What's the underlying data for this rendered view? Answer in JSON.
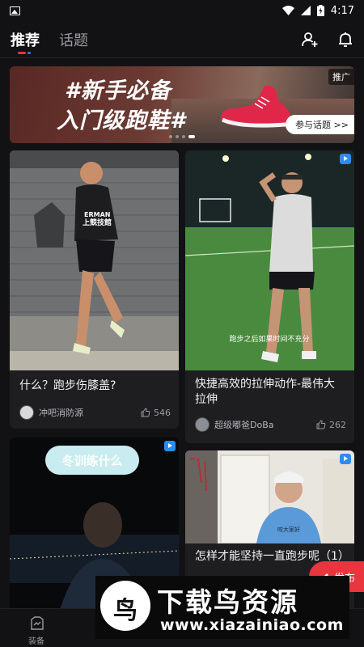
{
  "status_bar": {
    "time": "4:17"
  },
  "header": {
    "tabs": [
      {
        "label": "推荐",
        "active": true
      },
      {
        "label": "话题",
        "active": false
      }
    ],
    "icons": [
      "add-friend-icon",
      "bell-icon"
    ]
  },
  "banner": {
    "title_line1": "#新手必备",
    "title_line2": "入门级跑鞋#",
    "ad_label": "推广",
    "button_label": "参与话题 >>"
  },
  "feed": [
    {
      "title": "什么？跑步伤膝盖?",
      "author": "冲吧消防源",
      "likes": "546",
      "is_video": false,
      "image_text": [
        "ERMAN",
        "上競技館"
      ]
    },
    {
      "title": "快捷高效的拉伸动作-最伟大拉伸",
      "author": "超级嘟爸DoBa",
      "likes": "262",
      "is_video": true,
      "image_caption": "跑步之后如果时间不充分"
    },
    {
      "title": "",
      "author": "",
      "likes": "",
      "is_video": true,
      "image_caption": "冬训练什么"
    },
    {
      "title": "怎样才能坚持一直跑步呢（1）",
      "author": "",
      "likes": "",
      "is_video": true,
      "image_caption": "咬大家好"
    }
  ],
  "floating_button": {
    "label": "发布"
  },
  "bottom_nav": [
    {
      "label": "装备",
      "icon": "equipment-icon"
    }
  ],
  "watermark": {
    "logo_text": "鸟",
    "title": "下载鸟资源",
    "url": "www.xiazainiao.com"
  },
  "colors": {
    "accent": "#e8353e",
    "video_badge": "#2b8cf5",
    "background": "#121214",
    "card": "#1e1e21"
  }
}
